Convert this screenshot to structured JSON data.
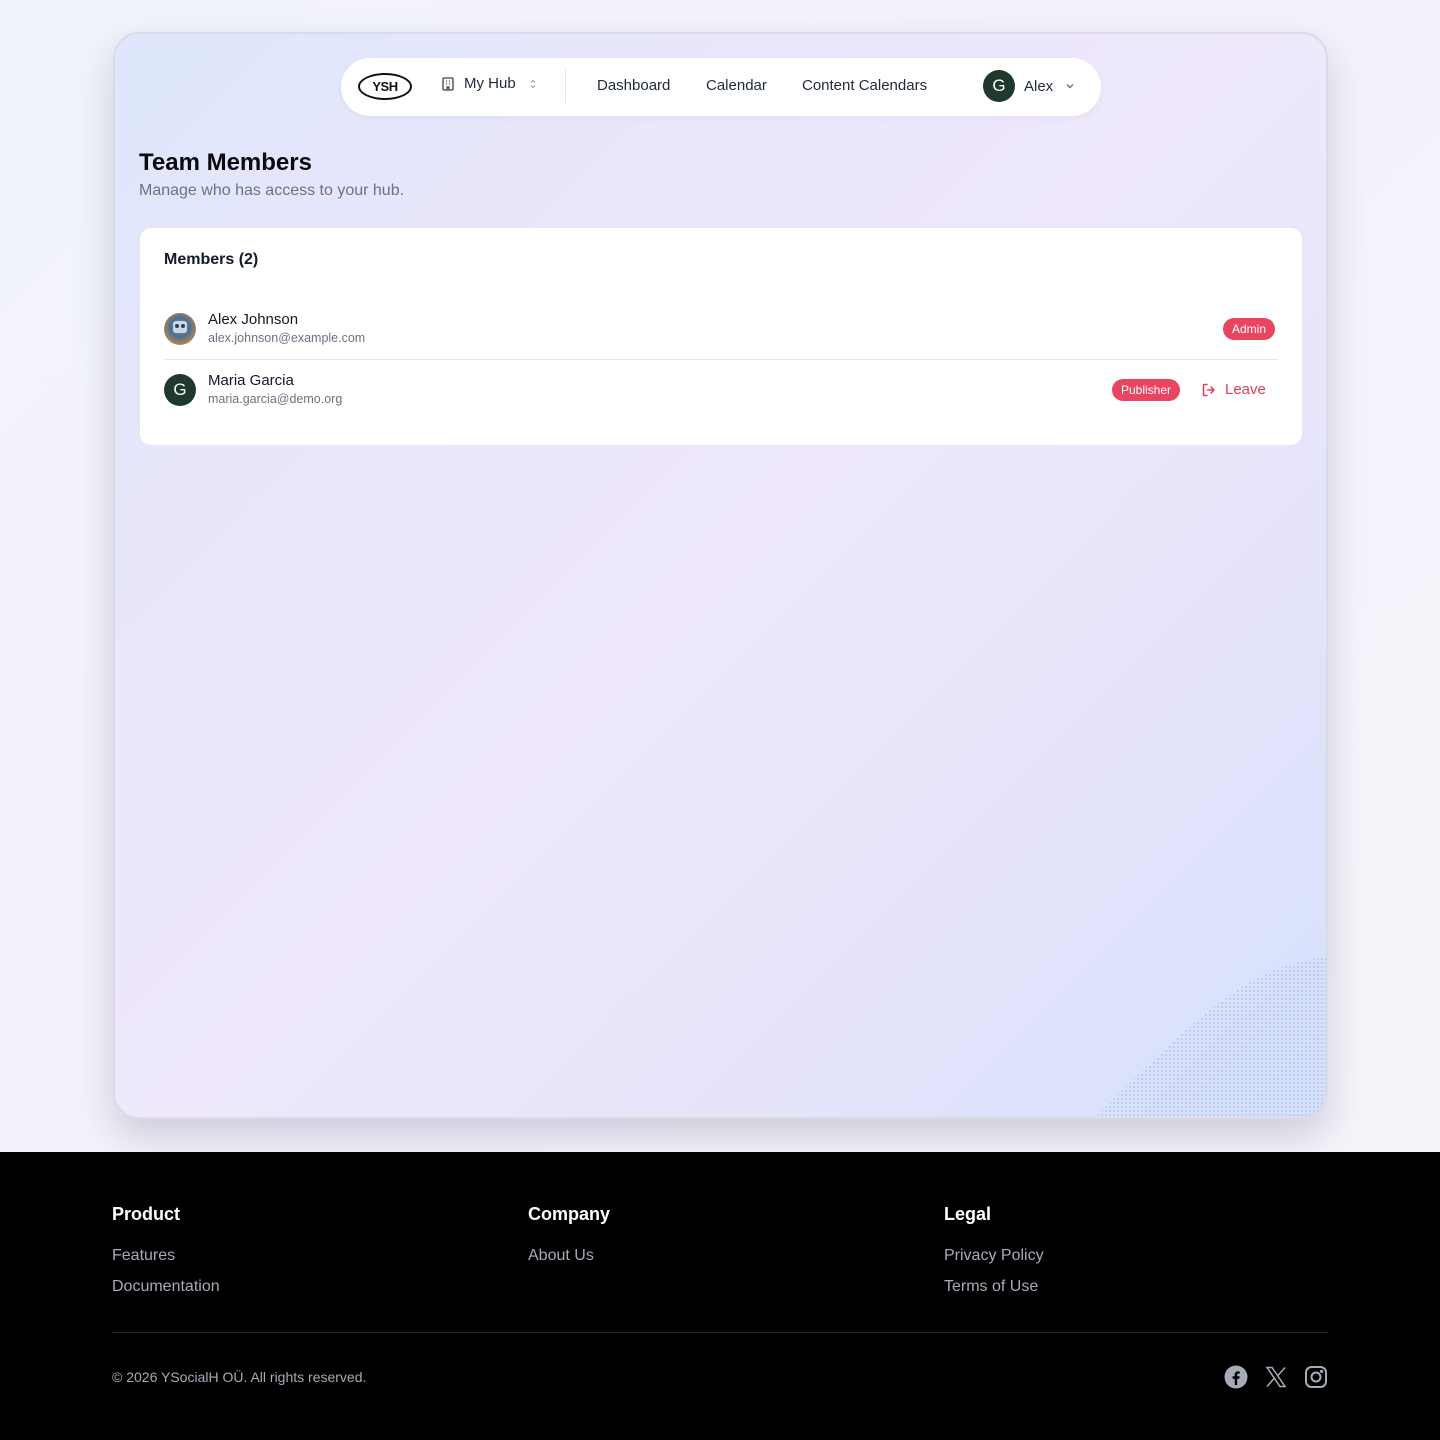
{
  "nav": {
    "logo": "YSH",
    "hub_label": "My Hub",
    "links": [
      "Dashboard",
      "Calendar",
      "Content Calendars"
    ],
    "user_initial": "G",
    "user_name": "Alex"
  },
  "page": {
    "title": "Team Members",
    "subtitle": "Manage who has access to your hub."
  },
  "members_card": {
    "title": "Members (2)",
    "members": [
      {
        "name": "Alex Johnson",
        "email": "alex.johnson@example.com",
        "role": "Admin",
        "avatar": "photo"
      },
      {
        "name": "Maria Garcia",
        "email": "maria.garcia@demo.org",
        "role": "Publisher",
        "avatar_initial": "G",
        "action": "Leave"
      }
    ]
  },
  "footer": {
    "columns": [
      {
        "heading": "Product",
        "links": [
          "Features",
          "Documentation"
        ]
      },
      {
        "heading": "Company",
        "links": [
          "About Us"
        ]
      },
      {
        "heading": "Legal",
        "links": [
          "Privacy Policy",
          "Terms of Use"
        ]
      }
    ],
    "copyright": "© 2026 YSocialH OÜ. All rights reserved.",
    "social": [
      "facebook-icon",
      "x-icon",
      "instagram-icon"
    ]
  },
  "colors": {
    "accent_badge": "#e94560",
    "leave_text": "#e03e55",
    "avatar_bg": "#1f3a2d",
    "footer_bg": "#000000"
  }
}
